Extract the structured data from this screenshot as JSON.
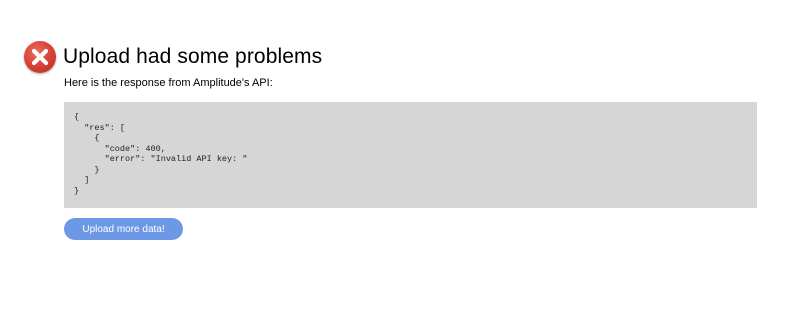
{
  "header": {
    "title": "Upload had some problems",
    "icon": "error-x-circle-icon",
    "icon_color": "#d9453a"
  },
  "intro_text": "Here is the response from Amplitude's API:",
  "response": {
    "code": "{\n  \"res\": [\n    {\n      \"code\": 400,\n      \"error\": \"Invalid API key: \"\n    }\n  ]\n}"
  },
  "upload_button": {
    "label": "Upload more data!",
    "color": "#6d98e6"
  }
}
